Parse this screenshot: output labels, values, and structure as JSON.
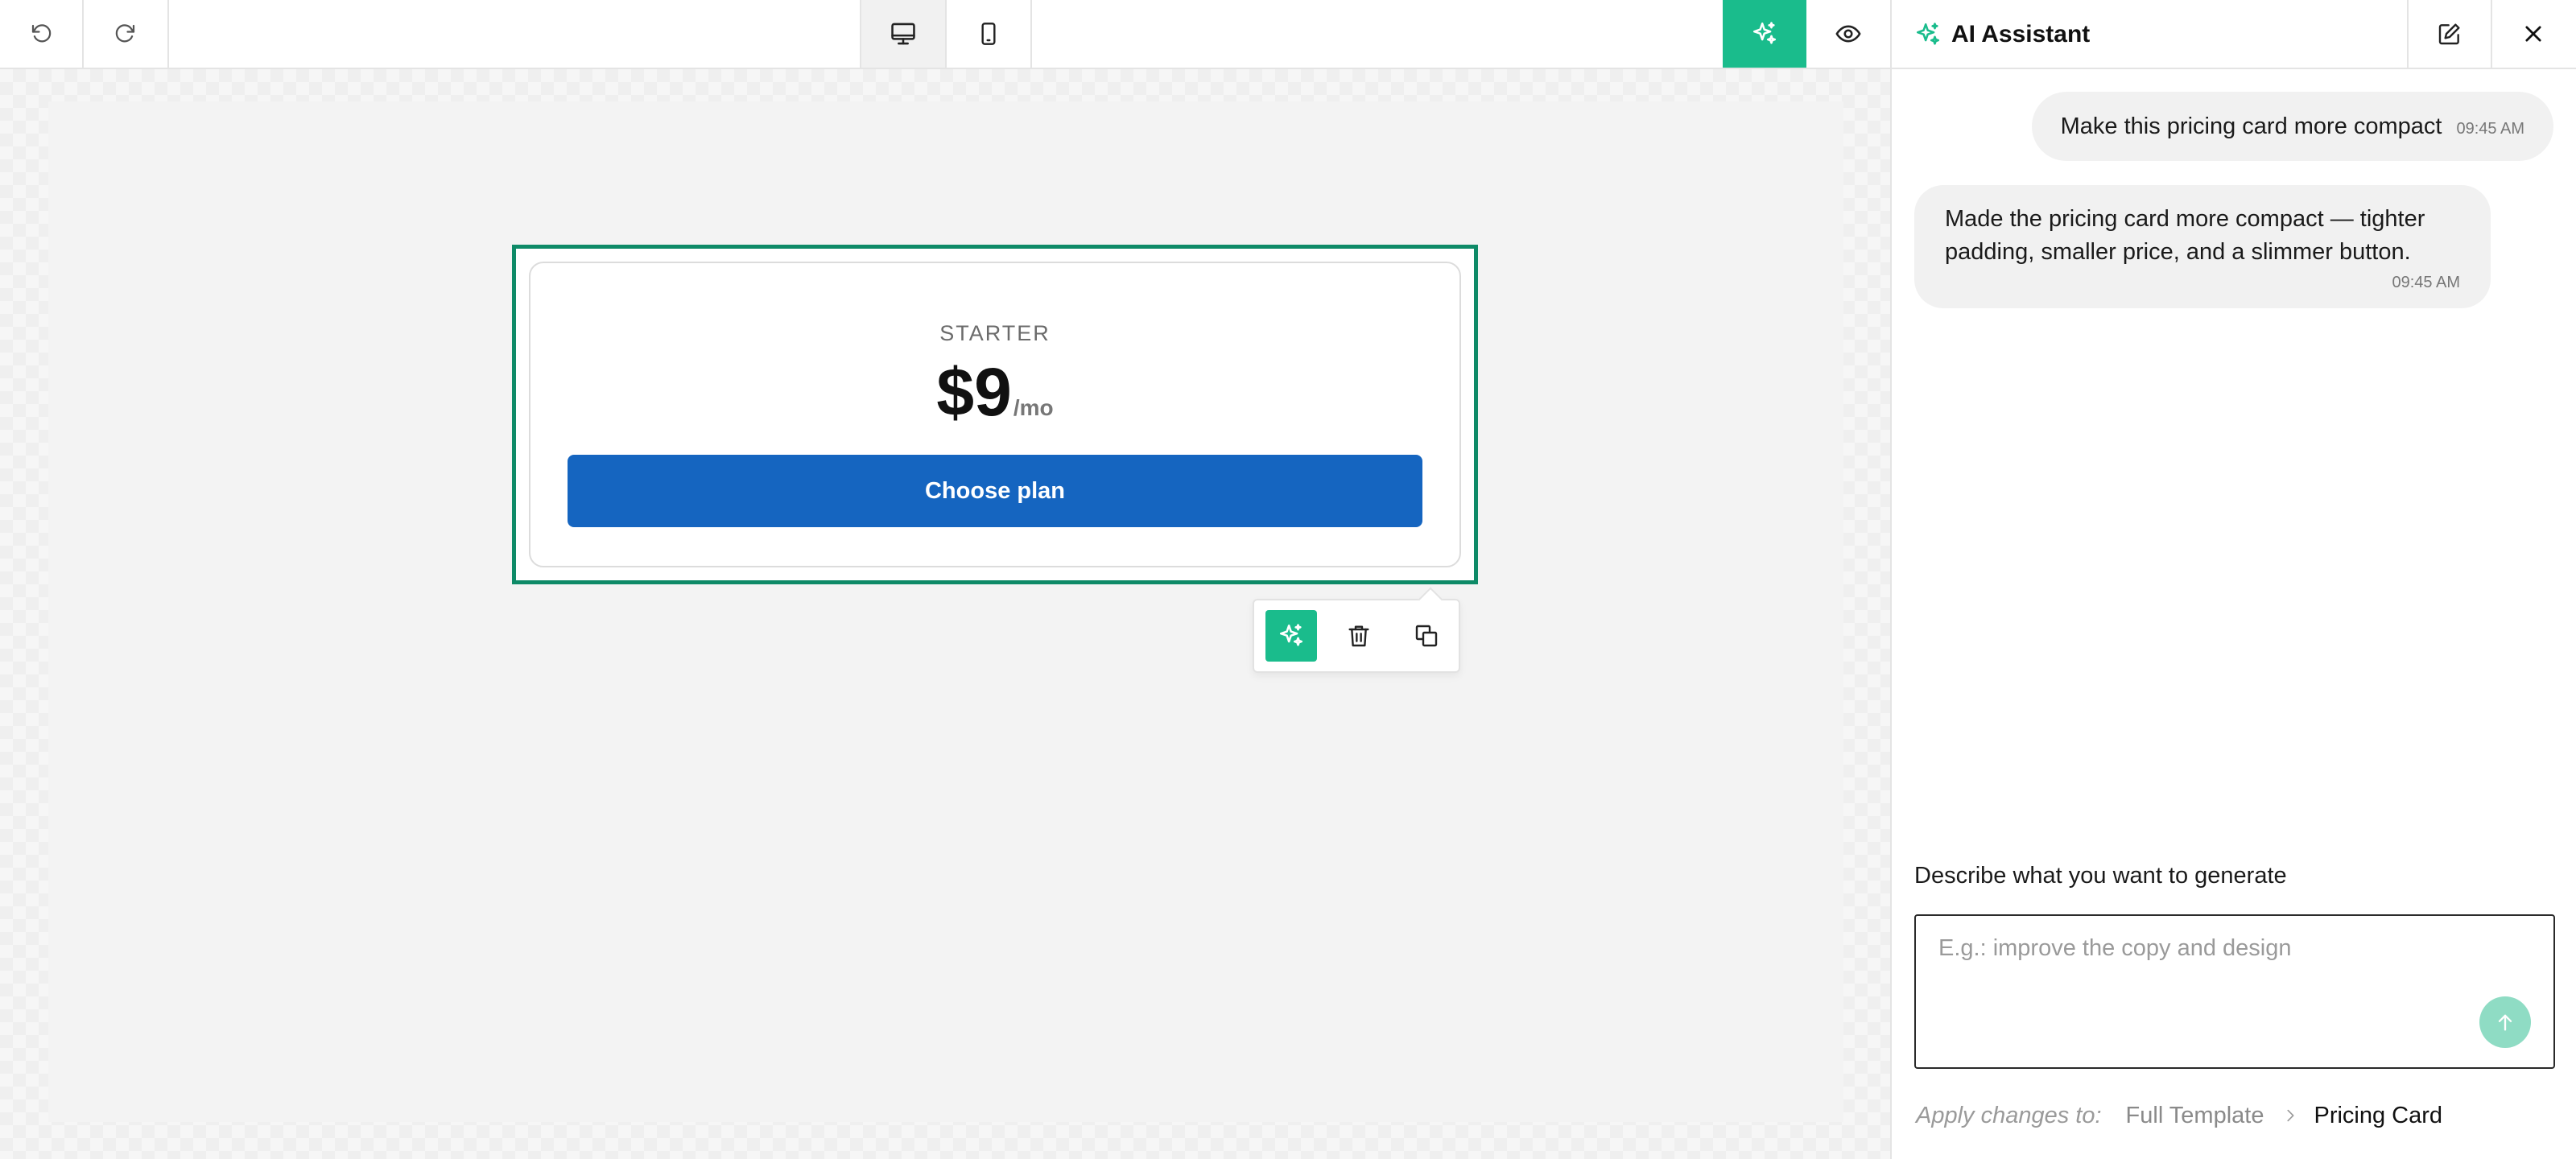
{
  "toolbar": {
    "undo_icon": "undo-icon",
    "redo_icon": "redo-icon",
    "desktop_icon": "desktop-icon",
    "mobile_icon": "mobile-icon",
    "ai_icon": "sparkles-icon",
    "preview_icon": "eye-icon",
    "accent_color": "#1abc8c"
  },
  "canvas": {
    "pricing_card": {
      "tier": "STARTER",
      "price": "$9",
      "period": "/mo",
      "button_label": "Choose plan",
      "button_color": "#1565c0"
    },
    "selection_color": "#0e8a67",
    "element_toolbar": {
      "ai_icon": "sparkles-icon",
      "delete_icon": "trash-icon",
      "duplicate_icon": "duplicate-icon"
    }
  },
  "panel": {
    "title": "AI Assistant",
    "messages": [
      {
        "role": "user",
        "text": "Make this pricing card more compact",
        "time": "09:45 AM"
      },
      {
        "role": "assistant",
        "text": "Made the pricing card more compact — tighter padding, smaller price, and a slimmer button.",
        "time": "09:45 AM"
      }
    ],
    "prompt_label": "Describe what you want to generate",
    "prompt_placeholder": "E.g.: improve the copy and design",
    "apply_label": "Apply changes to:",
    "scope": {
      "full": "Full Template",
      "current": "Pricing Card"
    }
  }
}
